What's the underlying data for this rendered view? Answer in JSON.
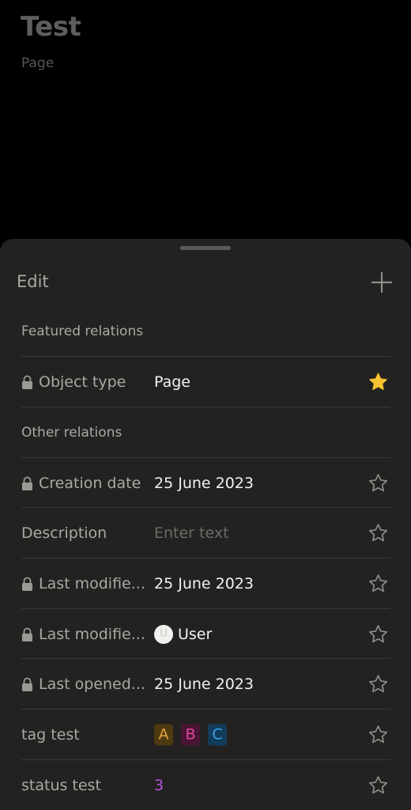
{
  "page": {
    "title": "Test",
    "subtitle": "Page"
  },
  "sheet": {
    "edit_label": "Edit",
    "add_icon": "plus-icon",
    "featured_section": "Featured relations",
    "other_section": "Other relations",
    "featured": [
      {
        "label": "Object type",
        "value": "Page",
        "locked": true,
        "starred": true
      }
    ],
    "relations": [
      {
        "label": "Creation date",
        "value": "25 June 2023",
        "locked": true
      },
      {
        "label": "Description",
        "placeholder": "Enter text",
        "locked": false
      },
      {
        "label": "Last modifie...",
        "value": "25 June 2023",
        "locked": true
      },
      {
        "label": "Last modifie...",
        "value": "User",
        "avatar_initial": "U",
        "locked": true
      },
      {
        "label": "Last opened...",
        "value": "25 June 2023",
        "locked": true
      },
      {
        "label": "tag test",
        "tags": [
          {
            "text": "A",
            "bg": "#4d3a10",
            "fg": "#e6a23c"
          },
          {
            "text": "B",
            "bg": "#4a1535",
            "fg": "#d9489a"
          },
          {
            "text": "C",
            "bg": "#123c5c",
            "fg": "#3da3e3"
          }
        ],
        "locked": false
      },
      {
        "label": "status test",
        "value": "3",
        "locked": false
      }
    ],
    "colors": {
      "star_filled": "#f7c22f",
      "star_outline": "#8e8d8a",
      "status": "#b455d9"
    }
  }
}
